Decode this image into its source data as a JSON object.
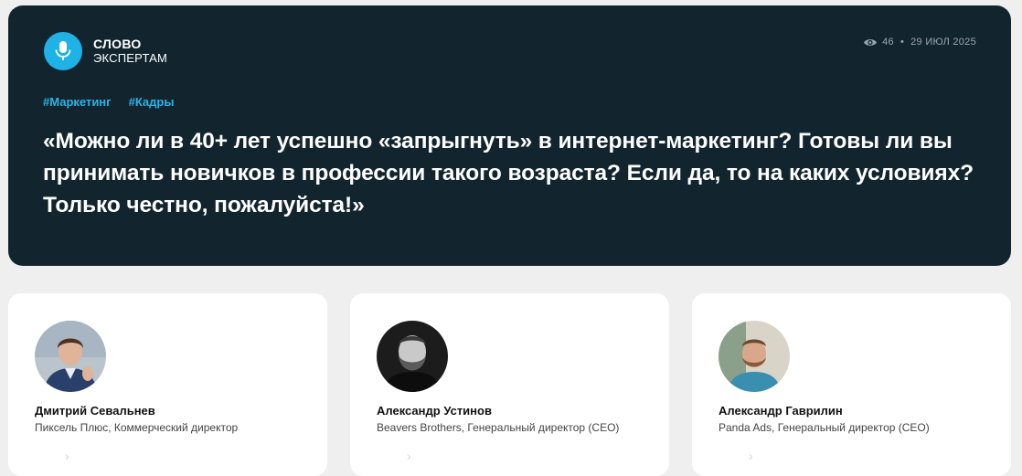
{
  "brand": {
    "line1": "СЛОВО",
    "line2": "ЭКСПЕРТАМ",
    "icon": "microphone-icon",
    "color": "#1fb2e6"
  },
  "meta": {
    "views": "46",
    "separator": "•",
    "date": "29 ИЮЛ 2025",
    "icon": "eye-icon"
  },
  "tags": [
    "#Маркетинг",
    "#Кадры"
  ],
  "headline": "«Можно ли в 40+ лет успешно «запрыгнуть» в интернет-маркетинг? Готовы ли вы принимать новичков в профессии такого возраста? Если да, то на каких условиях? Только честно, пожалуйста!»",
  "experts": [
    {
      "name": "Дмитрий Севальнев",
      "role": "Пиксель Плюс, Коммерческий директор"
    },
    {
      "name": "Александр Устинов",
      "role": "Beavers Brothers, Генеральный директор (CEO)"
    },
    {
      "name": "Александр Гаврилин",
      "role": "Panda Ads, Генеральный директор (CEO)"
    }
  ],
  "colors": {
    "hero_bg": "#12252f",
    "accent": "#2ab4e8",
    "page_bg": "#efefef"
  }
}
